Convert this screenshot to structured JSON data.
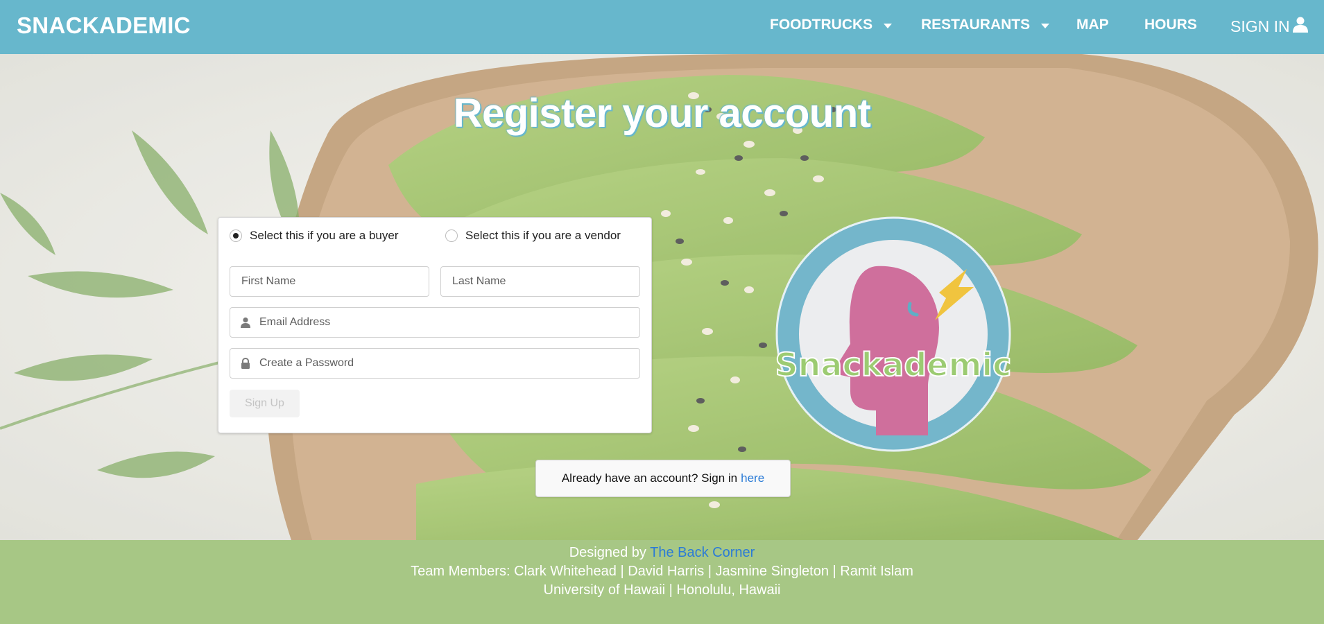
{
  "navbar": {
    "brand": "SNACKADEMIC",
    "items": [
      {
        "label": "FOODTRUCKS"
      },
      {
        "label": "RESTAURANTS"
      },
      {
        "label": "MAP"
      },
      {
        "label": "HOURS"
      },
      {
        "label": "SIGN IN"
      }
    ]
  },
  "hero": {
    "title": "Register your account"
  },
  "form": {
    "role_options": [
      {
        "label": "Select this if you are a buyer",
        "selected": true
      },
      {
        "label": "Select this if you are a vendor",
        "selected": false
      }
    ],
    "first_name": {
      "placeholder": "First Name",
      "value": ""
    },
    "last_name": {
      "placeholder": "Last Name",
      "value": ""
    },
    "email": {
      "placeholder": "Email Address",
      "value": "",
      "icon": "user-icon"
    },
    "password": {
      "placeholder": "Create a Password",
      "value": "",
      "icon": "lock-icon"
    },
    "submit_label": "Sign Up"
  },
  "logo": {
    "text": "Snackademic"
  },
  "signin_note": {
    "text": "Already have an account? Sign in",
    "link": "here"
  },
  "footer": {
    "designed_by_prefix": "Designed by",
    "designed_by_link": "The Back Corner",
    "team": "Team Members: Clark Whitehead | David Harris | Jasmine Singleton | Ramit Islam",
    "location": "University of Hawaii | Honolulu, Hawaii"
  },
  "colors": {
    "navbar": "#67b7cc",
    "footer": "#a7c785",
    "link": "#2b7bd6",
    "logo_ring": "#74b6cb",
    "logo_head": "#cf6f9c",
    "logo_bolt": "#f0c43f",
    "logo_text": "#9ccb72"
  }
}
